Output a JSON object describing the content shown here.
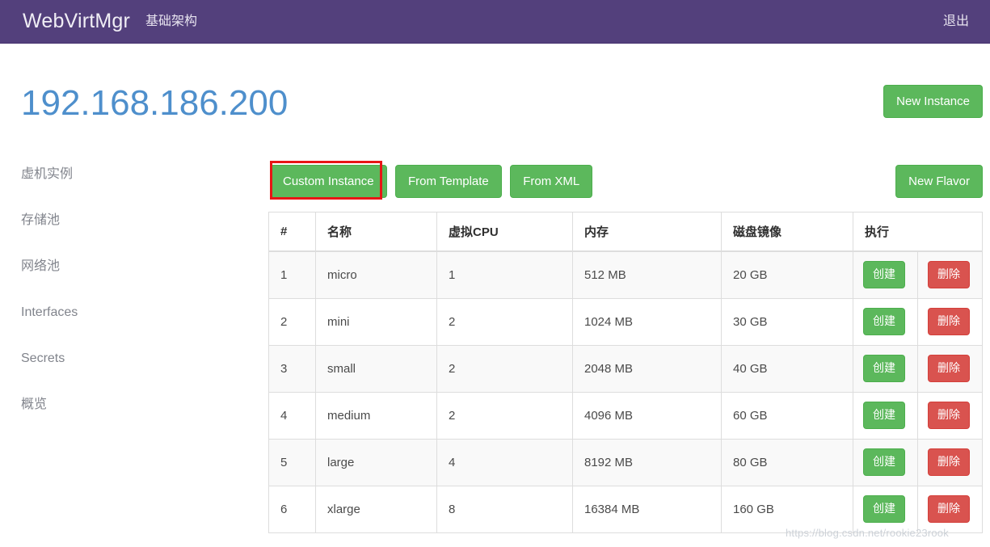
{
  "navbar": {
    "brand": "WebVirtMgr",
    "infrastructure_label": "基础架构",
    "logout_label": "退出",
    "background_color": "#53407c"
  },
  "header": {
    "title": "192.168.186.200",
    "title_color": "#4e8fcc",
    "new_instance_label": "New Instance"
  },
  "sidebar": {
    "items": [
      {
        "label": "虚机实例"
      },
      {
        "label": "存储池"
      },
      {
        "label": "网络池"
      },
      {
        "label": "Interfaces"
      },
      {
        "label": "Secrets"
      },
      {
        "label": "概览"
      }
    ]
  },
  "actions": {
    "custom_instance_label": "Custom Instance",
    "from_template_label": "From Template",
    "from_xml_label": "From XML",
    "new_flavor_label": "New Flavor",
    "highlight_color": "#e81515",
    "highlighted_button": "Custom Instance"
  },
  "table": {
    "headers": [
      "#",
      "名称",
      "虚拟CPU",
      "内存",
      "磁盘镜像",
      "执行"
    ],
    "row_create_label": "创建",
    "row_delete_label": "删除",
    "create_color": "#5cb85c",
    "delete_color": "#d9534f",
    "rows": [
      {
        "idx": "1",
        "name": "micro",
        "vcpu": "1",
        "memory": "512 MB",
        "disk": "20 GB"
      },
      {
        "idx": "2",
        "name": "mini",
        "vcpu": "2",
        "memory": "1024 MB",
        "disk": "30 GB"
      },
      {
        "idx": "3",
        "name": "small",
        "vcpu": "2",
        "memory": "2048 MB",
        "disk": "40 GB"
      },
      {
        "idx": "4",
        "name": "medium",
        "vcpu": "2",
        "memory": "4096 MB",
        "disk": "60 GB"
      },
      {
        "idx": "5",
        "name": "large",
        "vcpu": "4",
        "memory": "8192 MB",
        "disk": "80 GB"
      },
      {
        "idx": "6",
        "name": "xlarge",
        "vcpu": "8",
        "memory": "16384 MB",
        "disk": "160 GB"
      }
    ]
  },
  "watermark": {
    "text": "https://blog.csdn.net/rookie23rook"
  }
}
